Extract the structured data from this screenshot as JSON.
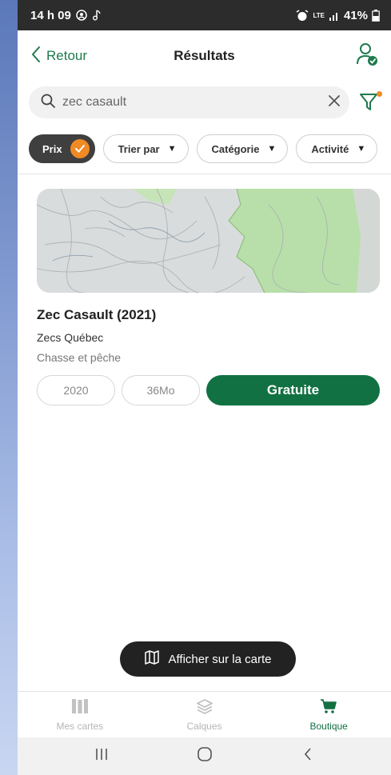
{
  "status": {
    "time": "14 h 09",
    "battery": "41%",
    "network": "LTE"
  },
  "header": {
    "back_label": "Retour",
    "title": "Résultats"
  },
  "search": {
    "value": "zec casault"
  },
  "filters": [
    {
      "label": "Prix"
    },
    {
      "label": "Trier par"
    },
    {
      "label": "Catégorie"
    },
    {
      "label": "Activité"
    }
  ],
  "result": {
    "name": "Zec Casault (2021)",
    "publisher": "Zecs Québec",
    "category": "Chasse et pêche",
    "year": "2020",
    "size": "36Mo",
    "price_label": "Gratuite"
  },
  "map_button_label": "Afficher sur la carte",
  "tabs": [
    {
      "label": "Mes cartes",
      "icon": "map-icon"
    },
    {
      "label": "Calques",
      "icon": "layers-icon"
    },
    {
      "label": "Boutique",
      "icon": "cart-icon"
    }
  ],
  "colors": {
    "accent": "#127142",
    "highlight": "#f08a24"
  }
}
